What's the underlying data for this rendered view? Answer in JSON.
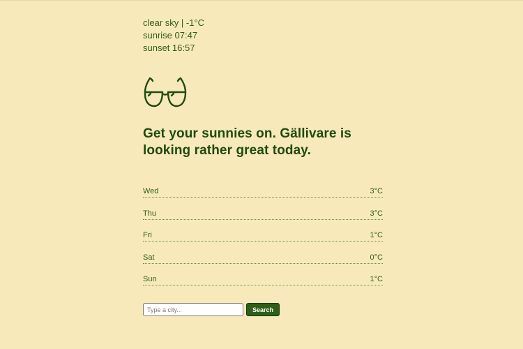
{
  "summary": {
    "condition_line": "clear sky | -1°C",
    "sunrise_line": "sunrise 07:47",
    "sunset_line": "sunset 16:57"
  },
  "icon": {
    "name": "sunglasses-icon",
    "color": "#1f4a0f"
  },
  "headline": "Get your sunnies on. Gällivare is looking rather great today.",
  "forecast": [
    {
      "day": "Wed",
      "temp": "3°C"
    },
    {
      "day": "Thu",
      "temp": "3°C"
    },
    {
      "day": "Fri",
      "temp": "1°C"
    },
    {
      "day": "Sat",
      "temp": "0°C"
    },
    {
      "day": "Sun",
      "temp": "1°C"
    }
  ],
  "search": {
    "placeholder": "Type a city...",
    "value": "",
    "button_label": "Search"
  },
  "colors": {
    "background": "#f7e9ba",
    "text": "#2c5a14",
    "button": "#2f5e18"
  }
}
